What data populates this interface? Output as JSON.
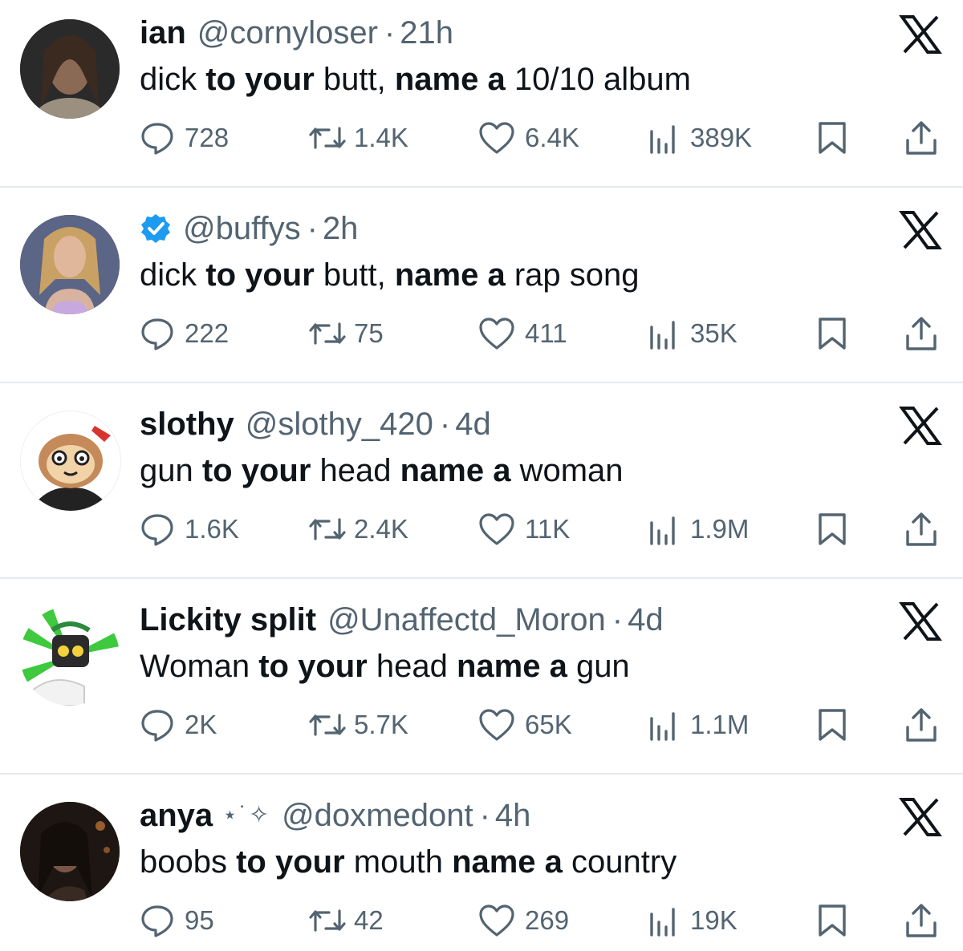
{
  "icons": {
    "reply": "speech-bubble-icon",
    "retweet": "retweet-arrows-icon",
    "like": "heart-icon",
    "views": "bar-chart-icon",
    "bookmark": "bookmark-icon",
    "share": "share-upload-icon",
    "platform": "x-logo-icon",
    "verified": "verified-badge-icon"
  },
  "colors": {
    "text_primary": "#0f1419",
    "text_secondary": "#536471",
    "verified_blue": "#1d9bf0",
    "divider": "#e6e9ec"
  },
  "tweets": [
    {
      "name": "ian",
      "handle": "@cornyloser",
      "separator": "·",
      "time": "21h",
      "text": {
        "a": "dick ",
        "b": "to your",
        "c": " butt, ",
        "d": "name a",
        "e": " 10/10 album"
      },
      "replies": "728",
      "retweets": "1.4K",
      "likes": "6.4K",
      "views": "389K"
    },
    {
      "name": "",
      "verified": true,
      "handle": "@buffys",
      "separator": "·",
      "time": "2h",
      "text": {
        "a": "dick ",
        "b": "to your",
        "c": " butt, ",
        "d": "name a",
        "e": " rap song"
      },
      "replies": "222",
      "retweets": "75",
      "likes": "411",
      "views": "35K"
    },
    {
      "name": "slothy",
      "handle": "@slothy_420",
      "separator": "·",
      "time": "4d",
      "text": {
        "a": "gun ",
        "b": "to your",
        "c": " head ",
        "d": "name a",
        "e": " woman"
      },
      "replies": "1.6K",
      "retweets": "2.4K",
      "likes": "11K",
      "views": "1.9M"
    },
    {
      "name": "Lickity split",
      "handle": "@Unaffectd_Moron",
      "separator": "·",
      "time": "4d",
      "text": {
        "a": "Woman ",
        "b": "to your",
        "c": " head ",
        "d": "name a",
        "e": " gun"
      },
      "replies": "2K",
      "retweets": "5.7K",
      "likes": "65K",
      "views": "1.1M"
    },
    {
      "name": "anya",
      "name_decoration": "⋆˙✧",
      "handle": "@doxmedont",
      "separator": "·",
      "time": "4h",
      "text": {
        "a": "boobs ",
        "b": "to your",
        "c": " mouth ",
        "d": "name a",
        "e": " country"
      },
      "replies": "95",
      "retweets": "42",
      "likes": "269",
      "views": "19K"
    }
  ]
}
